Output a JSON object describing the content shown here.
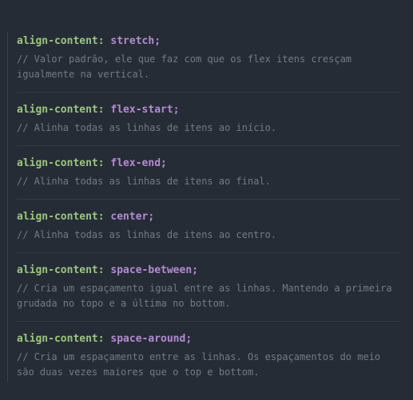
{
  "blocks": [
    {
      "property": "align-content:",
      "value": "stretch",
      "semicolon": ";",
      "comment": "// Valor padrão, ele que faz com que os flex itens cresçam igualmente na vertical."
    },
    {
      "property": "align-content:",
      "value": "flex-start",
      "semicolon": ";",
      "comment": "// Alinha todas as linhas de itens ao início."
    },
    {
      "property": "align-content:",
      "value": "flex-end",
      "semicolon": ";",
      "comment": "// Alinha todas as linhas de itens ao final."
    },
    {
      "property": "align-content:",
      "value": "center",
      "semicolon": ";",
      "comment": "// Alinha todas as linhas de itens ao centro."
    },
    {
      "property": "align-content:",
      "value": "space-between",
      "semicolon": ";",
      "comment": "// Cria um espaçamento igual entre as linhas. Mantendo a primeira grudada no topo e a última no bottom."
    },
    {
      "property": "align-content:",
      "value": "space-around",
      "semicolon": ";",
      "comment": "// Cria um espaçamento entre as linhas. Os espaçamentos do meio são duas vezes maiores que o top e bottom."
    }
  ]
}
